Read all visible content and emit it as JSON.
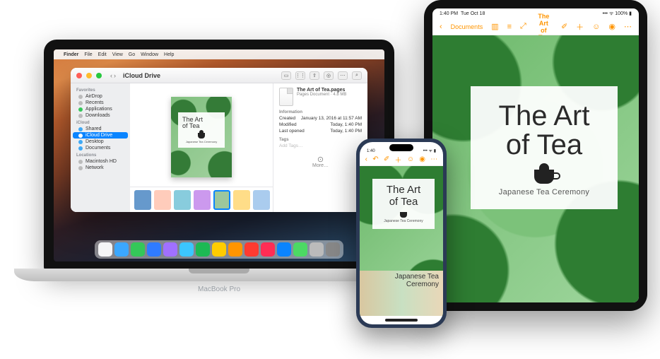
{
  "mac": {
    "label": "MacBook Pro",
    "menubar": {
      "apple": "",
      "app": "Finder",
      "items": [
        "File",
        "Edit",
        "View",
        "Go",
        "Window",
        "Help"
      ]
    },
    "finder": {
      "title": "iCloud Drive",
      "sidebar": {
        "favorites_label": "Favorites",
        "favorites": [
          {
            "label": "AirDrop"
          },
          {
            "label": "Recents"
          },
          {
            "label": "Applications"
          },
          {
            "label": "Downloads"
          }
        ],
        "icloud_label": "iCloud",
        "icloud": [
          {
            "label": "Shared"
          },
          {
            "label": "iCloud Drive",
            "selected": true
          },
          {
            "label": "Desktop"
          },
          {
            "label": "Documents"
          }
        ],
        "locations_label": "Locations",
        "locations": [
          {
            "label": "Macintosh HD"
          },
          {
            "label": "Network"
          }
        ]
      },
      "preview": {
        "title_line1": "The Art",
        "title_line2": "of Tea",
        "subtitle": "Japanese Tea Ceremony"
      },
      "info": {
        "filename": "The Art of Tea.pages",
        "kind": "Pages Document",
        "size": "4.8 MB",
        "section": "Information",
        "rows": [
          {
            "k": "Created",
            "v": "January 13, 2016 at 11:57 AM"
          },
          {
            "k": "Modified",
            "v": "Today, 1:40 PM"
          },
          {
            "k": "Last opened",
            "v": "Today, 1:40 PM"
          }
        ],
        "tags_label": "Tags",
        "tags_placeholder": "Add Tags…",
        "more": "More…"
      }
    }
  },
  "ipad": {
    "status_time": "1:40 PM",
    "status_date": "Tue Oct 18",
    "toolbar": {
      "back": "Documents",
      "title": "The Art of Tea"
    },
    "doc": {
      "title_line1": "The Art",
      "title_line2": "of Tea",
      "subtitle": "Japanese Tea Ceremony"
    }
  },
  "iphone": {
    "status_time": "1:40",
    "doc": {
      "title_line1": "The Art",
      "title_line2": "of Tea",
      "subtitle": "Japanese Tea Ceremony"
    },
    "section2": {
      "caption_line1": "Japanese Tea",
      "caption_line2": "Ceremony"
    }
  },
  "colors": {
    "ios_orange": "#ff9500",
    "mac_blue": "#0a84ff"
  }
}
